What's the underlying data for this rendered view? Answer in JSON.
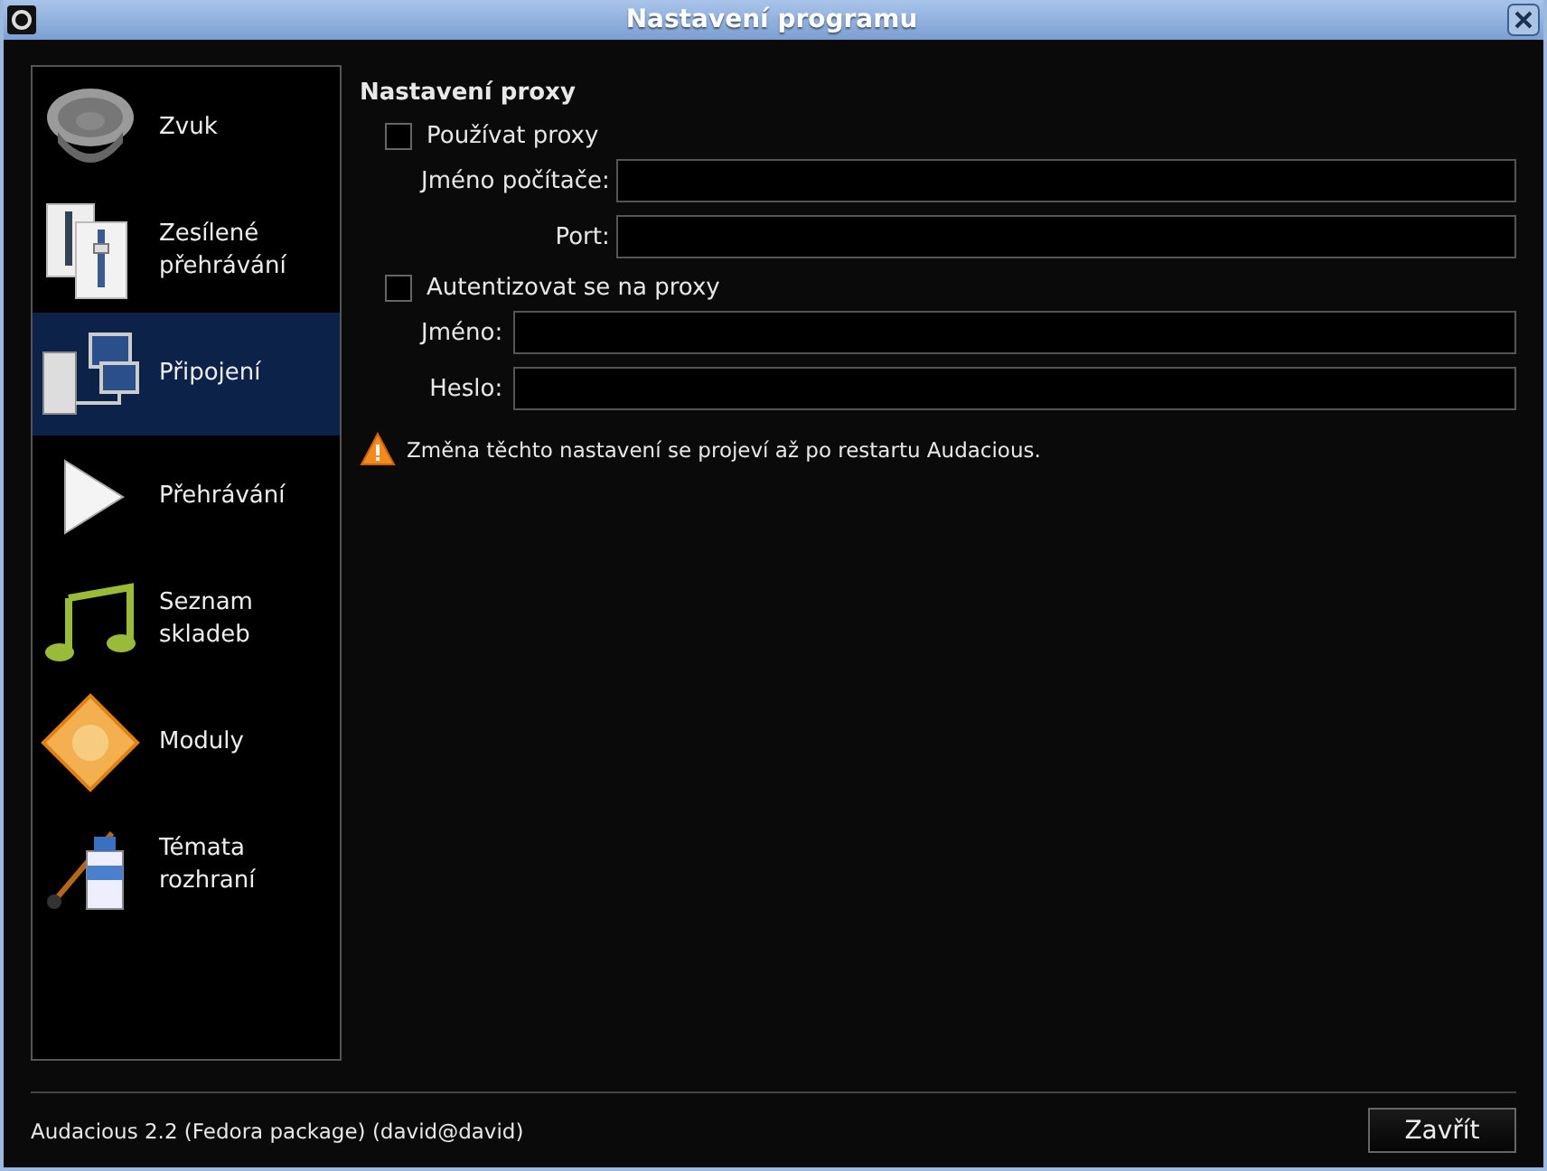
{
  "window": {
    "title": "Nastavení programu"
  },
  "sidebar": {
    "items": [
      {
        "label": "Zvuk",
        "kind": "speaker",
        "selected": false
      },
      {
        "label": "Zesílené\npřehrávání",
        "kind": "sliders",
        "selected": false
      },
      {
        "label": "Připojení",
        "kind": "network",
        "selected": true
      },
      {
        "label": "Přehrávání",
        "kind": "play",
        "selected": false
      },
      {
        "label": "Seznam\nskladeb",
        "kind": "note",
        "selected": false
      },
      {
        "label": "Moduly",
        "kind": "plugin",
        "selected": false
      },
      {
        "label": "Témata\nrozhraní",
        "kind": "paint",
        "selected": false
      }
    ]
  },
  "proxy": {
    "title": "Nastavení proxy",
    "use_proxy": {
      "label": "Používat proxy",
      "checked": false
    },
    "host": {
      "label": "Jméno počítače:"
    },
    "port": {
      "label": "Port:"
    },
    "auth": {
      "label": "Autentizovat se na proxy",
      "checked": false
    },
    "user": {
      "label": "Jméno:"
    },
    "password": {
      "label": "Heslo:"
    },
    "warning": "Změna těchto nastavení se projeví až po restartu Audacious."
  },
  "footer": {
    "version": "Audacious 2.2 (Fedora package) (david@david)",
    "close_button": "Zavřít"
  }
}
